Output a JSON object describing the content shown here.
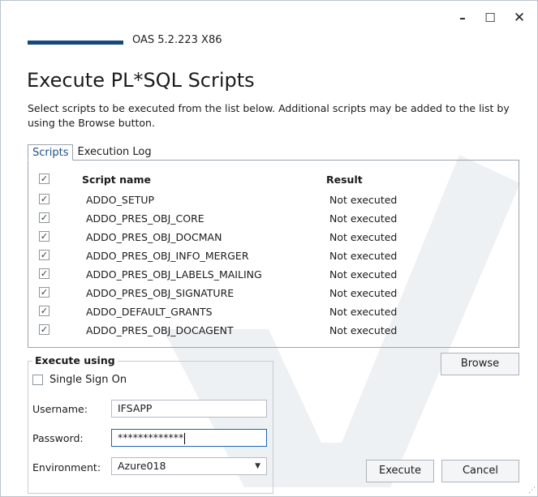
{
  "window": {
    "controls": {
      "minimize": "–",
      "maximize": "☐",
      "close": "✕"
    }
  },
  "header": {
    "version": "OAS 5.2.223 X86"
  },
  "title": "Execute PL*SQL Scripts",
  "description": "Select scripts to be executed from the list below. Additional scripts may be added to the list by using the Browse button.",
  "tabs": [
    {
      "label": "Scripts",
      "active": true
    },
    {
      "label": "Execution Log",
      "active": false
    }
  ],
  "table": {
    "headers": {
      "name": "Script name",
      "result": "Result"
    },
    "header_checked": true,
    "rows": [
      {
        "checked": true,
        "name": "ADDO_SETUP",
        "result": "Not executed"
      },
      {
        "checked": true,
        "name": "ADDO_PRES_OBJ_CORE",
        "result": "Not executed"
      },
      {
        "checked": true,
        "name": "ADDO_PRES_OBJ_DOCMAN",
        "result": "Not executed"
      },
      {
        "checked": true,
        "name": "ADDO_PRES_OBJ_INFO_MERGER",
        "result": "Not executed"
      },
      {
        "checked": true,
        "name": "ADDO_PRES_OBJ_LABELS_MAILING",
        "result": "Not executed"
      },
      {
        "checked": true,
        "name": "ADDO_PRES_OBJ_SIGNATURE",
        "result": "Not executed"
      },
      {
        "checked": true,
        "name": "ADDO_DEFAULT_GRANTS",
        "result": "Not executed"
      },
      {
        "checked": true,
        "name": "ADDO_PRES_OBJ_DOCAGENT",
        "result": "Not executed"
      }
    ]
  },
  "execute_using": {
    "legend": "Execute using",
    "sso_label": "Single Sign On",
    "sso_checked": false,
    "username_label": "Username:",
    "username_value": "IFSAPP",
    "password_label": "Password:",
    "password_value": "*************",
    "environment_label": "Environment:",
    "environment_value": "Azure018"
  },
  "buttons": {
    "browse": "Browse",
    "execute": "Execute",
    "cancel": "Cancel"
  },
  "colors": {
    "brand": "#14487f",
    "focus": "#1c63b7",
    "active_tab_text": "#1c4f8c"
  }
}
